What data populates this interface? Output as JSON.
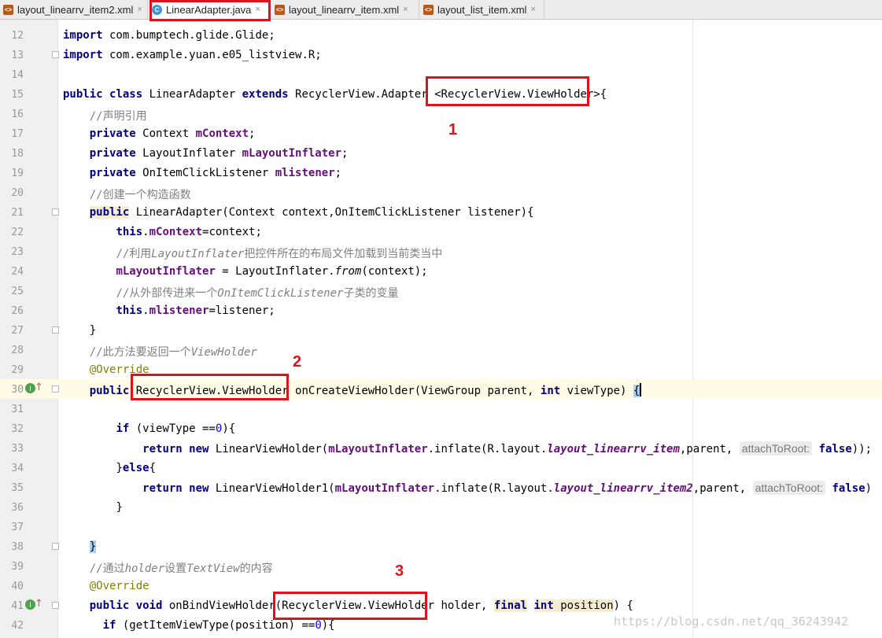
{
  "tabs": [
    {
      "label": "layout_linearrv_item2.xml",
      "type": "xml",
      "active": false
    },
    {
      "label": "LinearAdapter.java",
      "type": "class",
      "active": true
    },
    {
      "label": "layout_linearrv_item.xml",
      "type": "xml",
      "active": false
    },
    {
      "label": "layout_list_item.xml",
      "type": "xml",
      "active": false
    }
  ],
  "close_glyph": "×",
  "gutter": {
    "line_numbers": [
      "12",
      "13",
      "14",
      "15",
      "16",
      "17",
      "18",
      "19",
      "20",
      "21",
      "22",
      "23",
      "24",
      "25",
      "26",
      "27",
      "28",
      "29",
      "30",
      "31",
      "32",
      "33",
      "34",
      "35",
      "36",
      "37",
      "38",
      "39",
      "40",
      "41",
      "42"
    ],
    "override_icon_label": "I",
    "override_arrow": "↑"
  },
  "code": {
    "l12_import": "import",
    "l12_path": " com.bumptech.glide.Glide;",
    "l13_import": "import",
    "l13_path": " com.example.yuan.e05_listview.R;",
    "l15_public": "public",
    "l15_class": "class",
    "l15_name": " LinearAdapter ",
    "l15_extends": "extends",
    "l15_super": " RecyclerView.Adapter ",
    "l15_generic": "<RecyclerView.ViewHolder>",
    "l15_brace": "{",
    "l16_comment": "//声明引用",
    "l17_private": "private",
    "l17_type": " Context ",
    "l17_field": "mContext",
    "l17_semi": ";",
    "l18_private": "private",
    "l18_type": " LayoutInflater ",
    "l18_field": "mLayoutInflater",
    "l18_semi": ";",
    "l19_private": "private",
    "l19_type": " OnItemClickListener ",
    "l19_field": "mlistener",
    "l19_semi": ";",
    "l20_comment": "//创建一个构造函数",
    "l21_public": "public",
    "l21_sig": " LinearAdapter(Context context,OnItemClickListener listener){",
    "l22_this": "this",
    "l22_dot": ".",
    "l22_field": "mContext",
    "l22_rest": "=context;",
    "l23_c1": "//利用",
    "l23_ci": "LayoutInflater",
    "l23_c2": "把控件所在的布局文件加载到当前类当中",
    "l24_field": "mLayoutInflater",
    "l24_mid": " = LayoutInflater.",
    "l24_from": "from",
    "l24_rest": "(context);",
    "l25_c1": "//从外部传进来一个",
    "l25_ci": "OnItemClickListener",
    "l25_c2": "子类的变量",
    "l26_this": "this",
    "l26_dot": ".",
    "l26_field": "mlistener",
    "l26_rest": "=listener;",
    "l27_brace": "}",
    "l28_c1": "//此方法要返回一个",
    "l28_ci": "ViewHolder",
    "l29_ann": "@Override",
    "l30_public": "public",
    "l30_type": "RecyclerView.ViewHolder",
    "l30_sig": " onCreateViewHolder(ViewGroup parent, ",
    "l30_int": "int",
    "l30_rest": " viewType) ",
    "l30_brace": "{",
    "l32_if": "if",
    "l32_cond": " (viewType ==",
    "l32_zero": "0",
    "l32_end": "){",
    "l33_return": "return",
    "l33_new": "new",
    "l33_cls": " LinearViewHolder(",
    "l33_field": "mLayoutInflater",
    "l33_mid": ".inflate(R.layout.",
    "l33_res": "layout_linearrv_item",
    "l33_parent": ",parent, ",
    "l33_hint": "attachToRoot:",
    "l33_false": "false",
    "l33_end": "));",
    "l34_open": "}",
    "l34_else": "else",
    "l34_close": "{",
    "l35_return": "return",
    "l35_new": "new",
    "l35_cls": " LinearViewHolder1(",
    "l35_field": "mLayoutInflater",
    "l35_mid": ".inflate(R.layout.",
    "l35_res": "layout_linearrv_item2",
    "l35_parent": ",parent, ",
    "l35_hint": "attachToRoot:",
    "l35_false": "false",
    "l35_end": ")",
    "l36_brace": "}",
    "l38_brace": "}",
    "l39_c1": "//通过",
    "l39_ci1": "holder",
    "l39_c2": "设置",
    "l39_ci2": "TextView",
    "l39_c3": "的内容",
    "l40_ann": "@Override",
    "l41_public": "public",
    "l41_void": "void",
    "l41_name": " onBindViewHolder(",
    "l41_type": "RecyclerView.ViewHolder",
    "l41_holder": " holder, ",
    "l41_final": "final",
    "l41_int": "int",
    "l41_pos": " position",
    "l41_end": ") {",
    "l42_if": "if",
    "l42_cond": " (getItemViewType(position) ==",
    "l42_zero": "0",
    "l42_end": "){"
  },
  "annotations": {
    "mark1": "1",
    "mark2": "2",
    "mark3": "3"
  },
  "watermark": "https://blog.csdn.net/qq_36243942"
}
